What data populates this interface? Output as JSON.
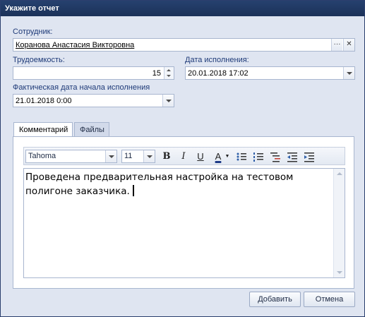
{
  "window": {
    "title": "Укажите отчет"
  },
  "employee": {
    "label": "Сотрудник:",
    "value": "Коранова Анастасия Викторовна",
    "ellipsis": "···",
    "clear": "✕"
  },
  "effort": {
    "label": "Трудоемкость:",
    "value": "15"
  },
  "due_date": {
    "label": "Дата исполнения:",
    "value": "20.01.2018 17:02"
  },
  "actual_start": {
    "label": "Фактическая дата начала исполнения",
    "value": "21.01.2018 0:00"
  },
  "tabs": [
    {
      "label": "Комментарий",
      "active": true
    },
    {
      "label": "Файлы",
      "active": false
    }
  ],
  "toolbar": {
    "font": "Tahoma",
    "size": "11",
    "bold": "B",
    "italic": "I",
    "underline": "U",
    "color": "A"
  },
  "editor": {
    "text": "Проведена предварительная настройка на тестовом полигоне заказчика."
  },
  "buttons": {
    "add": "Добавить",
    "cancel": "Отмена"
  }
}
